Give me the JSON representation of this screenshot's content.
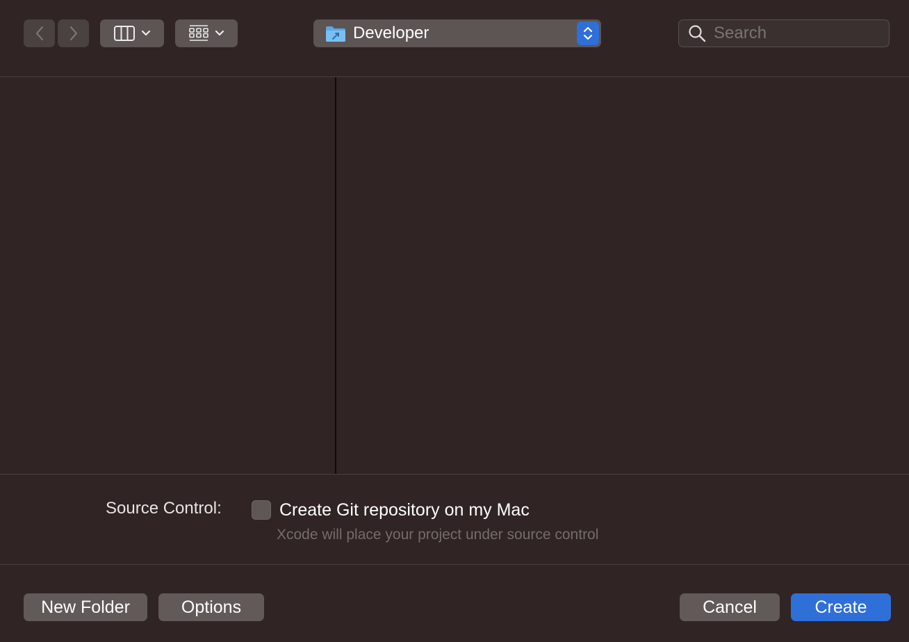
{
  "toolbar": {
    "back_icon": "chevron-left-icon",
    "forward_icon": "chevron-right-icon",
    "view_mode_icon": "column-view-icon",
    "group_icon": "grid-view-icon",
    "location": {
      "name": "Developer",
      "icon": "developer-folder-icon"
    },
    "search": {
      "placeholder": "Search",
      "value": ""
    }
  },
  "options": {
    "source_control_label": "Source Control:",
    "git_checkbox_label": "Create Git repository on my Mac",
    "git_checked": false,
    "git_help": "Xcode will place your project under source control"
  },
  "buttons": {
    "new_folder": "New Folder",
    "options": "Options",
    "cancel": "Cancel",
    "create": "Create"
  },
  "colors": {
    "background": "#302424",
    "accent": "#2f6fd8",
    "button": "#625959"
  }
}
